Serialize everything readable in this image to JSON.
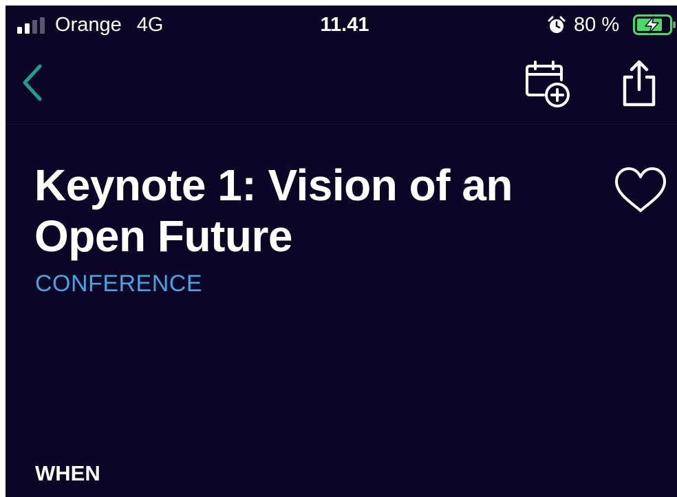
{
  "status_bar": {
    "carrier": "Orange",
    "network": "4G",
    "time": "11.41",
    "battery_percent": "80 %",
    "signal_icon": "signal-bars-icon",
    "alarm_icon": "alarm-clock-icon",
    "battery_icon": "battery-charging-icon",
    "signal_bars_filled": 2,
    "signal_bars_total": 4,
    "battery_level": 0.8,
    "battery_color": "#4cd964"
  },
  "nav_bar": {
    "back_icon": "chevron-left-icon",
    "add_to_calendar_icon": "calendar-add-icon",
    "share_icon": "share-icon",
    "accent_color": "#1f9e8f"
  },
  "session": {
    "title": "Keynote 1: Vision of an Open Future",
    "track": "CONFERENCE",
    "favorite_icon": "heart-outline-icon",
    "track_color": "#4aa3df"
  },
  "sections": {
    "when_heading": "WHEN"
  },
  "colors": {
    "background": "#0b0526",
    "text": "#ffffff"
  }
}
